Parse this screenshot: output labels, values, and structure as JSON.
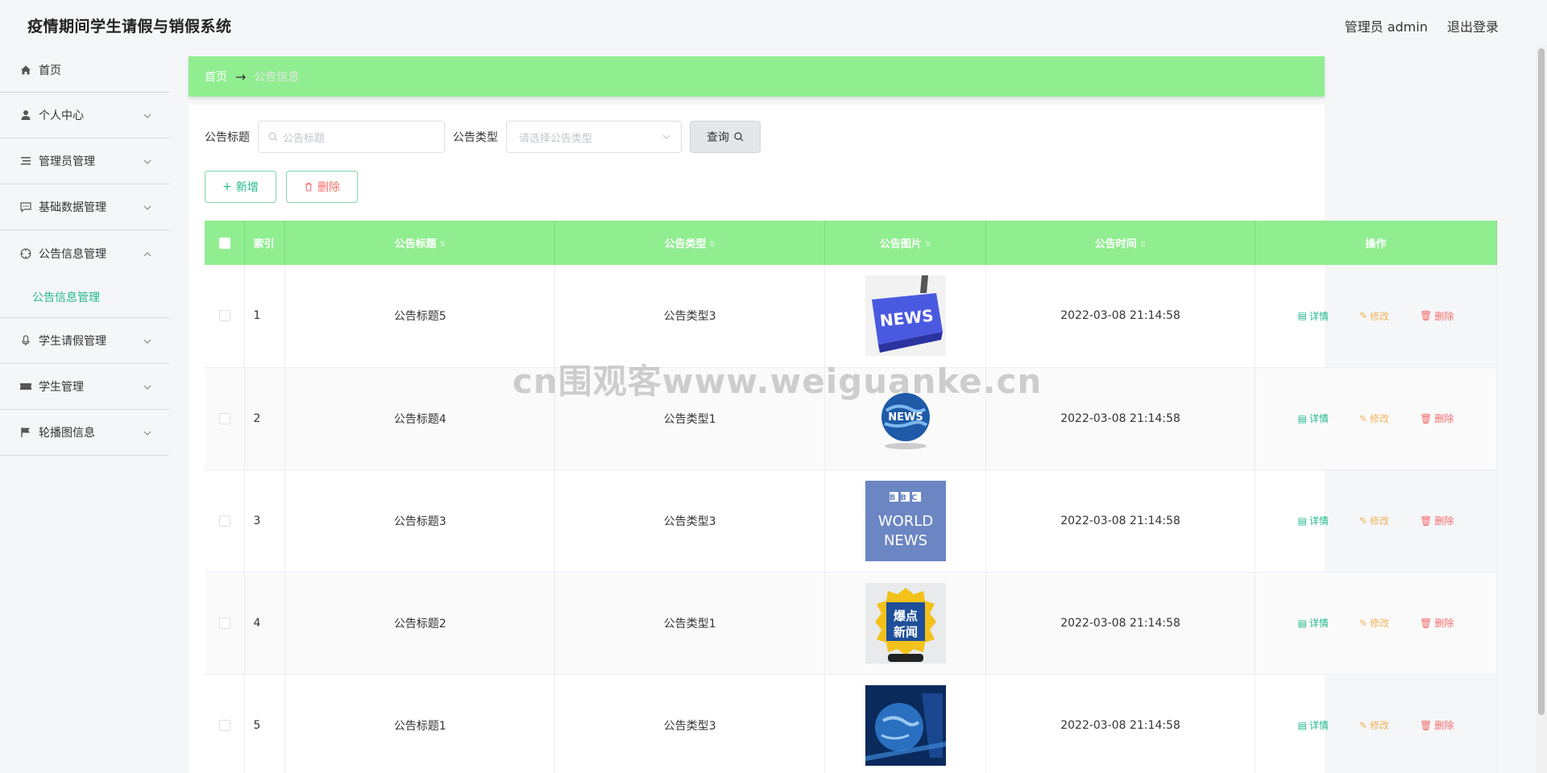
{
  "header": {
    "title": "疫情期间学生请假与销假系统",
    "user": "管理员 admin",
    "logout": "退出登录"
  },
  "sidebar": {
    "items": [
      {
        "label": "首页",
        "icon": "home-icon"
      },
      {
        "label": "个人中心",
        "icon": "user-icon"
      },
      {
        "label": "管理员管理",
        "icon": "list-icon"
      },
      {
        "label": "基础数据管理",
        "icon": "chat-icon"
      },
      {
        "label": "公告信息管理",
        "icon": "compass-icon"
      },
      {
        "label": "学生请假管理",
        "icon": "mic-icon"
      },
      {
        "label": "学生管理",
        "icon": "ticket-icon"
      },
      {
        "label": "轮播图信息",
        "icon": "flag-icon"
      }
    ],
    "sub_item": "公告信息管理"
  },
  "breadcrumb": {
    "home": "首页",
    "arrow": "→",
    "current": "公告信息"
  },
  "filter": {
    "title_label": "公告标题",
    "title_placeholder": "公告标题",
    "type_label": "公告类型",
    "type_placeholder": "请选择公告类型",
    "query": "查询"
  },
  "actions": {
    "add": "新增",
    "delete": "删除"
  },
  "table": {
    "headers": [
      "索引",
      "公告标题",
      "公告类型",
      "公告图片",
      "公告时间",
      "操作"
    ],
    "row_actions": {
      "detail": "详情",
      "edit": "修改",
      "remove": "删除"
    },
    "rows": [
      {
        "index": "1",
        "title": "公告标题5",
        "type": "公告类型3",
        "image": "news-key-image",
        "time": "2022-03-08 21:14:58"
      },
      {
        "index": "2",
        "title": "公告标题4",
        "type": "公告类型1",
        "image": "news-globe-image",
        "time": "2022-03-08 21:14:58"
      },
      {
        "index": "3",
        "title": "公告标题3",
        "type": "公告类型3",
        "image": "bbc-world-news-image",
        "time": "2022-03-08 21:14:58"
      },
      {
        "index": "4",
        "title": "公告标题2",
        "type": "公告类型1",
        "image": "baodian-news-image",
        "time": "2022-03-08 21:14:58"
      },
      {
        "index": "5",
        "title": "公告标题1",
        "type": "公告类型3",
        "image": "earth-news-image",
        "time": "2022-03-08 21:14:58"
      }
    ]
  },
  "images": {
    "bbc_line1": "BBC",
    "bbc_line2": "WORLD",
    "bbc_line3": "NEWS",
    "news_key": "NEWS",
    "baodian1": "爆点",
    "baodian2": "新闻",
    "globe": "NEWS"
  },
  "watermark": "cn围观客www.weiguanke.cn",
  "colors": {
    "accent": "#21b98a",
    "header_green": "#90ee90",
    "edit": "#f2b35b",
    "danger": "#f56c6c"
  }
}
